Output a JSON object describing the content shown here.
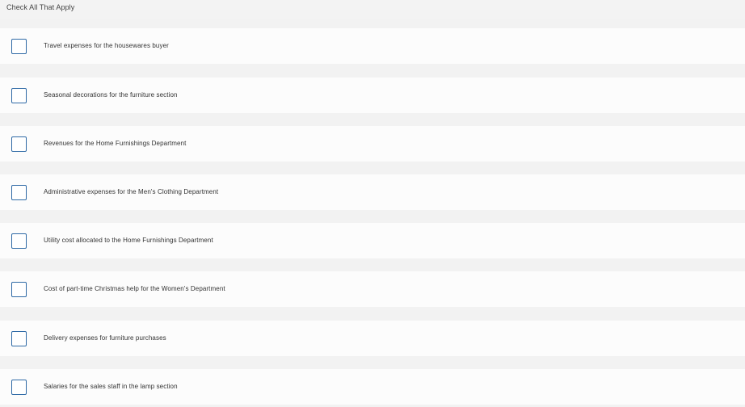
{
  "header": {
    "instruction": "Check All That Apply"
  },
  "options": [
    {
      "label": "Travel expenses for the housewares buyer",
      "checked": false
    },
    {
      "label": "Seasonal decorations for the furniture section",
      "checked": false
    },
    {
      "label": "Revenues for the Home Furnishings Department",
      "checked": false
    },
    {
      "label": "Administrative expenses for the Men's Clothing Department",
      "checked": false
    },
    {
      "label": "Utility cost allocated to the Home Furnishings Department",
      "checked": false
    },
    {
      "label": "Cost of part-time Christmas help for the Women's Department",
      "checked": false
    },
    {
      "label": "Delivery expenses for furniture purchases",
      "checked": false
    },
    {
      "label": "Salaries for the sales staff in the lamp section",
      "checked": false
    }
  ],
  "colors": {
    "checkbox_border": "#2f6aa6",
    "row_background": "#fcfcfc",
    "page_background": "#f2f2f2"
  }
}
